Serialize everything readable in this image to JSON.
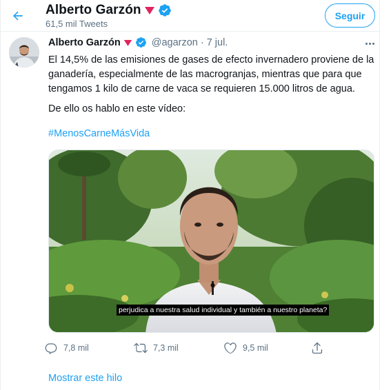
{
  "header": {
    "name": "Alberto Garzón",
    "tweets_count": "61,5 mil Tweets",
    "follow_label": "Seguir"
  },
  "tweet": {
    "author_name": "Alberto Garzón",
    "handle": "@agarzon",
    "separator": "·",
    "date": "7 jul.",
    "text_lines": [
      "El 14,5% de las emisiones de gases de efecto invernadero proviene de la",
      "ganadería, especialmente de las macrogranjas, mientras que para que",
      "tengamos 1 kilo de carne de vaca se requieren 15.000 litros de agua."
    ],
    "text_second": "De ello os hablo en este vídeo:",
    "hashtag": "#MenosCarneMásVida",
    "video_caption": "perjudica a nuestra salud individual y también a nuestro planeta?",
    "stats": {
      "replies": "7,8 mil",
      "retweets": "7,3 mil",
      "likes": "9,5 mil"
    },
    "show_thread": "Mostrar este hilo"
  },
  "colors": {
    "accent": "#1da1f2",
    "muted": "#5b7083",
    "verified": "#1da1f2",
    "rose_emoji": "#e0245e"
  },
  "icons": [
    "back-arrow-icon",
    "red-triangle-emoji-icon",
    "verified-badge-icon",
    "more-options-icon",
    "reply-icon",
    "retweet-icon",
    "like-icon",
    "share-icon"
  ]
}
